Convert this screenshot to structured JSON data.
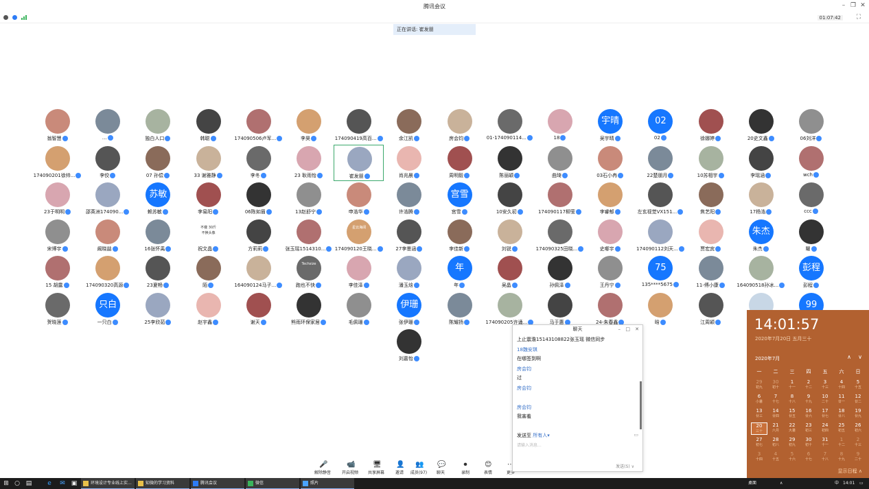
{
  "window": {
    "title": "腾讯会议",
    "minimize": "–",
    "restore": "❐",
    "close": "✕"
  },
  "status": {
    "timer": "01:07:42",
    "fullscreen": "⛶"
  },
  "speaking": "正在讲话: 崔发朋",
  "participants": [
    [
      "翁智慧",
      "…",
      "独白人口",
      "韩聪",
      "174090506卢军...",
      "李昊",
      "174090419高百...",
      "余江凯",
      "房会钧",
      "01-174090114...",
      "18",
      "吴宇晴",
      "02",
      "徐娜婷",
      "20史文鑫",
      "06刘洋"
    ],
    [
      "174090201徐帅...",
      "李佼",
      "07 孙偿",
      "33 谢雅静",
      "李冬",
      "23 耿雨怡",
      "崔发朋",
      "肖兆晨",
      "周明毅",
      "陈丽颖",
      "曲琦",
      "03石小冉",
      "22楚朋月",
      "10苏相宇",
      "李瑶涵",
      "wch"
    ],
    [
      "23于明明",
      "邵英洲174090...",
      "赖苏敏",
      "李易阳",
      "06陈如眉",
      "13赵舒宁",
      "申浩华",
      "许浩腾",
      "宫雪",
      "10安久初",
      "174090117柳莹",
      "李睿郁",
      "左玄视觉VX151...",
      "焦艺阳",
      "17杨浩",
      "ccc"
    ],
    [
      "宋博宇",
      "阚晓喆",
      "16张怀禹",
      "祝文晶",
      "方莉莉",
      "张玉瑶1514310...",
      "174090120王晓...",
      "27李墨涵",
      "李佳新",
      "刘锐",
      "174090325田晓...",
      "史哪宇",
      "174090112刘天...",
      "贾宏宾",
      "朱杰",
      "曜"
    ],
    [
      "15 胡露",
      "174090320高源",
      "23夏畅",
      "陌",
      "164090124马子...",
      "跑也不快",
      "李佳泽",
      "潘玉焓",
      "年",
      "吴晶",
      "孙佩泽",
      "王丹宁",
      "135****5675",
      "11-傅小康",
      "164090518孙冰...",
      "彭程"
    ],
    [
      "贺晓莲",
      "一只白",
      "25李欣茹",
      "赵宇鑫",
      "谢天",
      "熊雨环保家居",
      "毛佩珊",
      "张伊珊",
      "陈耀扬",
      "174090205许诵...",
      "马于惠",
      "24-朱春鑫",
      "晗",
      "江周颖",
      "",
      ""
    ],
    [
      "刘嘉怡"
    ]
  ],
  "avatar_text": {
    "0-11": "宇晴",
    "0-12": "02",
    "2-2": "苏敏",
    "2-8": "宫雪",
    "3-14": "朱杰",
    "4-8": "年",
    "4-12": "75",
    "4-15": "彭程",
    "5-1": "只白",
    "5-7": "伊珊",
    "5-15": "99"
  },
  "avatar_inner": {
    "3-3": "不瘦 30斤\n不换头像",
    "3-6": "星云海阔",
    "4-5": "Techsize"
  },
  "toolbar": [
    {
      "label": "解除静音",
      "icon": "🎤"
    },
    {
      "label": "开启视频",
      "icon": "📹"
    },
    {
      "label": "共享屏幕",
      "icon": "🖥"
    },
    {
      "label": "邀请",
      "icon": "👤"
    },
    {
      "label": "成员(97)",
      "icon": "👥"
    },
    {
      "label": "聊天",
      "icon": "💬"
    },
    {
      "label": "录制",
      "icon": "⏺"
    },
    {
      "label": "表情",
      "icon": "😊"
    },
    {
      "label": "更多",
      "icon": "⋯"
    }
  ],
  "chat": {
    "title": "聊天",
    "messages": [
      {
        "type": "text",
        "text": "上止震澹15143108822张玉瑶 微信同步"
      },
      {
        "type": "sender",
        "text": "18魏安琪"
      },
      {
        "type": "text",
        "text": "在哪签到啊"
      },
      {
        "type": "sender",
        "text": "房会钧"
      },
      {
        "type": "text",
        "text": "过"
      },
      {
        "type": "sender",
        "text": "房会钧"
      },
      {
        "type": "text",
        "text": ""
      },
      {
        "type": "sender",
        "text": "房会钧"
      },
      {
        "type": "text",
        "text": "我害羞"
      }
    ],
    "send_to_label": "发送至",
    "send_to_target": "所有人",
    "input_placeholder": "请输入消息...",
    "send_label": "发送(S)"
  },
  "clock": {
    "time": "14:01:57",
    "date": "2020年7月20日 五月三十",
    "month": "2020年7月",
    "weekdays": [
      "一",
      "二",
      "三",
      "四",
      "五",
      "六",
      "日"
    ],
    "days": [
      [
        "29",
        "初九"
      ],
      [
        "30",
        "初十"
      ],
      [
        "1",
        "十一"
      ],
      [
        "2",
        "十二"
      ],
      [
        "3",
        "十三"
      ],
      [
        "4",
        "十四"
      ],
      [
        "5",
        "十五"
      ],
      [
        "6",
        "小暑"
      ],
      [
        "7",
        "十七"
      ],
      [
        "8",
        "十八"
      ],
      [
        "9",
        "十九"
      ],
      [
        "10",
        "二十"
      ],
      [
        "11",
        "廿一"
      ],
      [
        "12",
        "廿二"
      ],
      [
        "13",
        "廿三"
      ],
      [
        "14",
        "廿四"
      ],
      [
        "15",
        "廿五"
      ],
      [
        "16",
        "廿六"
      ],
      [
        "17",
        "廿七"
      ],
      [
        "18",
        "廿八"
      ],
      [
        "19",
        "廿九"
      ],
      [
        "20",
        "三十"
      ],
      [
        "21",
        "六月"
      ],
      [
        "22",
        "大暑"
      ],
      [
        "23",
        "初三"
      ],
      [
        "24",
        "初四"
      ],
      [
        "25",
        "初五"
      ],
      [
        "26",
        "初六"
      ],
      [
        "27",
        "初七"
      ],
      [
        "28",
        "初八"
      ],
      [
        "29",
        "初九"
      ],
      [
        "30",
        "初十"
      ],
      [
        "31",
        "十一"
      ],
      [
        "1",
        "十二"
      ],
      [
        "2",
        "十三"
      ],
      [
        "3",
        "十四"
      ],
      [
        "4",
        "十五"
      ],
      [
        "5",
        "十六"
      ],
      [
        "6",
        "十七"
      ],
      [
        "7",
        "十八"
      ],
      [
        "8",
        "十九"
      ],
      [
        "9",
        "二十"
      ]
    ],
    "show_schedule": "显示日程 ∧"
  },
  "taskbar": {
    "items": [
      "环境设计专业线上实...",
      "知微的学习资料",
      "腾讯会议",
      "微信",
      "照片"
    ],
    "tray": [
      "桌面",
      "∧",
      "中",
      "14:01"
    ]
  },
  "colors": {
    "accent": "#1677ff",
    "clock_bg": "#b26130",
    "taskbar": "#1c1c1c"
  }
}
